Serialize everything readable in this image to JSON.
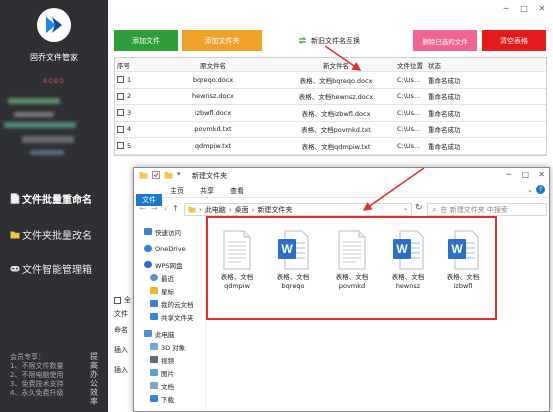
{
  "sidebar": {
    "app_title": "固乔文件管家",
    "user_name": "BOBO",
    "nav": [
      {
        "label": "文件批量重命名",
        "icon": "document-icon",
        "active": true
      },
      {
        "label": "文件夹批量改名",
        "icon": "folder-icon",
        "active": false
      },
      {
        "label": "文件智能管理箱",
        "icon": "gamepad-icon",
        "active": false
      }
    ],
    "promo_lines": [
      "会员专享：",
      "1、不限文件数量",
      "2、不限电脑使用",
      "3、免费技术支持",
      "4、永久免费升级"
    ],
    "promo_vertical": "提高办公效率"
  },
  "toolbar": {
    "add_file": "添加文件",
    "add_folder": "添加文件夹",
    "new_old_swap": "新旧文件名互换",
    "delete_selected": "删除已选的文件",
    "clear_list": "清空表格"
  },
  "colors": {
    "add_file": "#2e9e3a",
    "add_folder": "#f0a12a",
    "delete_selected": "#f06596",
    "clear_list": "#e21b1b",
    "highlight": "#e0302e",
    "sidebar_bg": "#2f3034",
    "accent_blue": "#1979ca"
  },
  "table": {
    "headers": [
      "序号",
      "原文件名",
      "新文件名",
      "文件位置",
      "状态"
    ],
    "rows": [
      {
        "index": "1",
        "original": "bqreqo.docx",
        "new": "表格、文档bqreqo.docx",
        "location": "C:\\Us...",
        "status": "重命名成功"
      },
      {
        "index": "2",
        "original": "hewnsz.docx",
        "new": "表格、文档hewnsz.docx",
        "location": "C:\\Us...",
        "status": "重命名成功"
      },
      {
        "index": "3",
        "original": "izbwfl.docx",
        "new": "表格、文档izbwfl.docx",
        "location": "C:\\Us...",
        "status": "重命名成功"
      },
      {
        "index": "4",
        "original": "povmkd.txt",
        "new": "表格、文档povmkd.txt",
        "location": "C:\\Us...",
        "status": "重命名成功"
      },
      {
        "index": "5",
        "original": "qdmpiw.txt",
        "new": "表格、文档qdmpiw.txt",
        "location": "C:\\Us...",
        "status": "重命名成功"
      }
    ]
  },
  "lower_panel": {
    "select_all": "全",
    "labels": [
      "文件",
      "命名",
      "插入",
      "插入"
    ]
  },
  "explorer": {
    "title": "新建文件夹",
    "ribbon_tabs": [
      "文件",
      "主页",
      "共享",
      "查看"
    ],
    "breadcrumb": [
      "此电脑",
      "桌面",
      "新建文件夹"
    ],
    "search_placeholder": "在 新建文件夹 中搜索",
    "nav_items": [
      {
        "label": "快速访问",
        "icon": "star-icon"
      },
      {
        "label": "OneDrive",
        "icon": "cloud-icon"
      },
      {
        "label": "WPS网盘",
        "icon": "cloud-drive-icon"
      },
      {
        "label": "最近",
        "icon": "clock-icon"
      },
      {
        "label": "星标",
        "icon": "star-icon"
      },
      {
        "label": "我的云文档",
        "icon": "cloud-doc-icon"
      },
      {
        "label": "共享文件夹",
        "icon": "share-folder-icon"
      },
      {
        "label": "此电脑",
        "icon": "computer-icon"
      },
      {
        "label": "3D 对象",
        "icon": "cube-icon"
      },
      {
        "label": "视频",
        "icon": "video-icon"
      },
      {
        "label": "图片",
        "icon": "picture-icon"
      },
      {
        "label": "文档",
        "icon": "document-icon"
      },
      {
        "label": "下载",
        "icon": "download-icon"
      }
    ],
    "files": [
      {
        "line1": "表格、文档",
        "line2": "qdmpiw",
        "type": "txt"
      },
      {
        "line1": "表格、文档",
        "line2": "bqreqo",
        "type": "word"
      },
      {
        "line1": "表格、文档",
        "line2": "povmkd",
        "type": "txt"
      },
      {
        "line1": "表格、文档",
        "line2": "hewnsz",
        "type": "word"
      },
      {
        "line1": "表格、文档",
        "line2": "izbwfl",
        "type": "word"
      }
    ]
  }
}
